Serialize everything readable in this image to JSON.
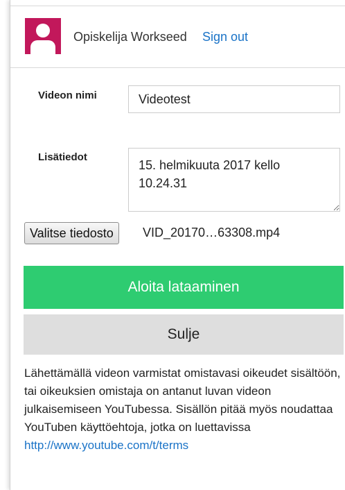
{
  "header": {
    "user_name": "Opiskelija Workseed",
    "sign_out": "Sign out"
  },
  "form": {
    "name_label": "Videon nimi",
    "name_value": "Videotest",
    "info_label": "Lisätiedot",
    "info_value": "15. helmikuuta 2017 kello 10.24.31",
    "file_button": "Valitse tiedosto",
    "file_name": "VID_20170…63308.mp4"
  },
  "actions": {
    "upload_label": "Aloita lataaminen",
    "close_label": "Sulje"
  },
  "disclaimer": {
    "text": "Lähettämällä videon varmistat omistavasi oikeudet sisältöön, tai oikeuksien omistaja on antanut luvan videon julkaisemiseen YouTubessa. Sisällön pitää myös noudattaa YouTuben käyttöehtoja, jotka on luettavissa",
    "link": "http://www.youtube.com/t/terms"
  },
  "colors": {
    "primary_green": "#2ecc71",
    "link_blue": "#1a73c7",
    "avatar_magenta": "#c2185b",
    "secondary_gray": "#dedede"
  }
}
